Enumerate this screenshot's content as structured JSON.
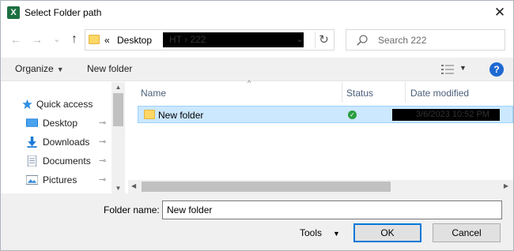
{
  "window": {
    "title": "Select Folder path",
    "app_icon": "X",
    "close_glyph": "✕"
  },
  "navigation": {
    "back_glyph": "←",
    "forward_glyph": "→",
    "recent_glyph": "⌄",
    "up_glyph": "↑"
  },
  "address": {
    "overflow": "«",
    "segments": [
      "Desktop",
      "HT",
      "›",
      "222"
    ],
    "redacted_text": "HT  ›  222",
    "dropdown_glyph": "⌄",
    "refresh_glyph": "↻"
  },
  "search": {
    "placeholder": "Search 222"
  },
  "toolbar": {
    "organize_label": "Organize",
    "new_folder_label": "New folder",
    "caret": "▼"
  },
  "sidebar": {
    "items": [
      {
        "label": "Quick access",
        "icon": "star-icon",
        "pinned": false
      },
      {
        "label": "Desktop",
        "icon": "desktop-icon",
        "pinned": true
      },
      {
        "label": "Downloads",
        "icon": "downloads-icon",
        "pinned": true
      },
      {
        "label": "Documents",
        "icon": "documents-icon",
        "pinned": true
      },
      {
        "label": "Pictures",
        "icon": "pictures-icon",
        "pinned": true
      }
    ],
    "pin_glyph": "📌"
  },
  "file_list": {
    "columns": [
      "Name",
      "Status",
      "Date modified"
    ],
    "sort_glyph": "^",
    "rows": [
      {
        "name": "New folder",
        "status": "synced",
        "date_modified": "3/6/2023 10:52 PM"
      }
    ],
    "status_glyph": "✓"
  },
  "footer": {
    "folder_name_label": "Folder name:",
    "folder_name_value": "New folder",
    "tools_label": "Tools",
    "ok_label": "OK",
    "cancel_label": "Cancel"
  },
  "colors": {
    "selection": "#cce8ff",
    "selection_border": "#99d1ff",
    "accent": "#0078d7",
    "excel_green": "#1d6f42",
    "folder_yellow": "#ffd766"
  }
}
